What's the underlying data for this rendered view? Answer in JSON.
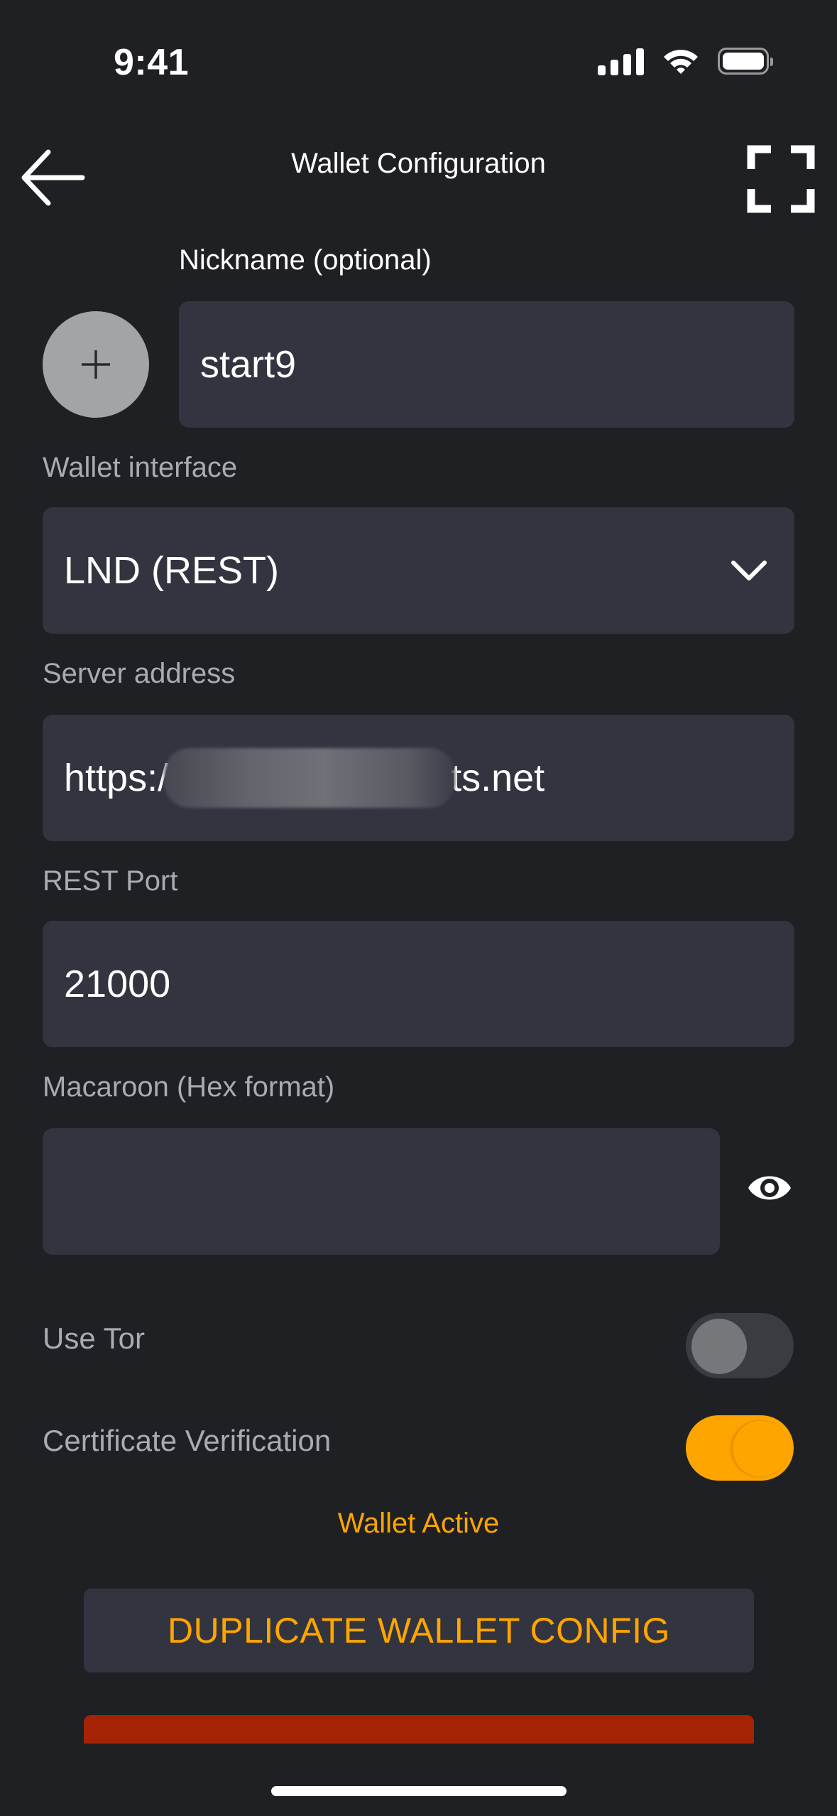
{
  "status_bar": {
    "time": "9:41"
  },
  "header": {
    "title": "Wallet Configuration",
    "back_icon": "arrow-left-icon",
    "scan_icon": "scan-frame-icon"
  },
  "nickname": {
    "label": "Nickname (optional)",
    "value": "start9",
    "avatar_icon": "plus-icon"
  },
  "wallet_interface": {
    "label": "Wallet interface",
    "selected": "LND (REST)",
    "chevron_icon": "chevron-down-icon"
  },
  "server_address": {
    "label": "Server address",
    "value_prefix": "https:/",
    "value_suffix": "ts.net"
  },
  "rest_port": {
    "label": "REST Port",
    "value": "21000"
  },
  "macaroon": {
    "label": "Macaroon (Hex format)",
    "value": "",
    "visibility_icon": "eye-icon"
  },
  "toggles": {
    "use_tor": {
      "label": "Use Tor",
      "enabled": false
    },
    "certificate_verification": {
      "label": "Certificate Verification",
      "enabled": true
    }
  },
  "wallet_status": "Wallet Active",
  "buttons": {
    "duplicate": "DUPLICATE WALLET CONFIG"
  },
  "colors": {
    "background": "#1f2023",
    "field": "#32343f",
    "accent": "#ffa500",
    "danger": "#a52205",
    "label": "#a8abb2"
  }
}
